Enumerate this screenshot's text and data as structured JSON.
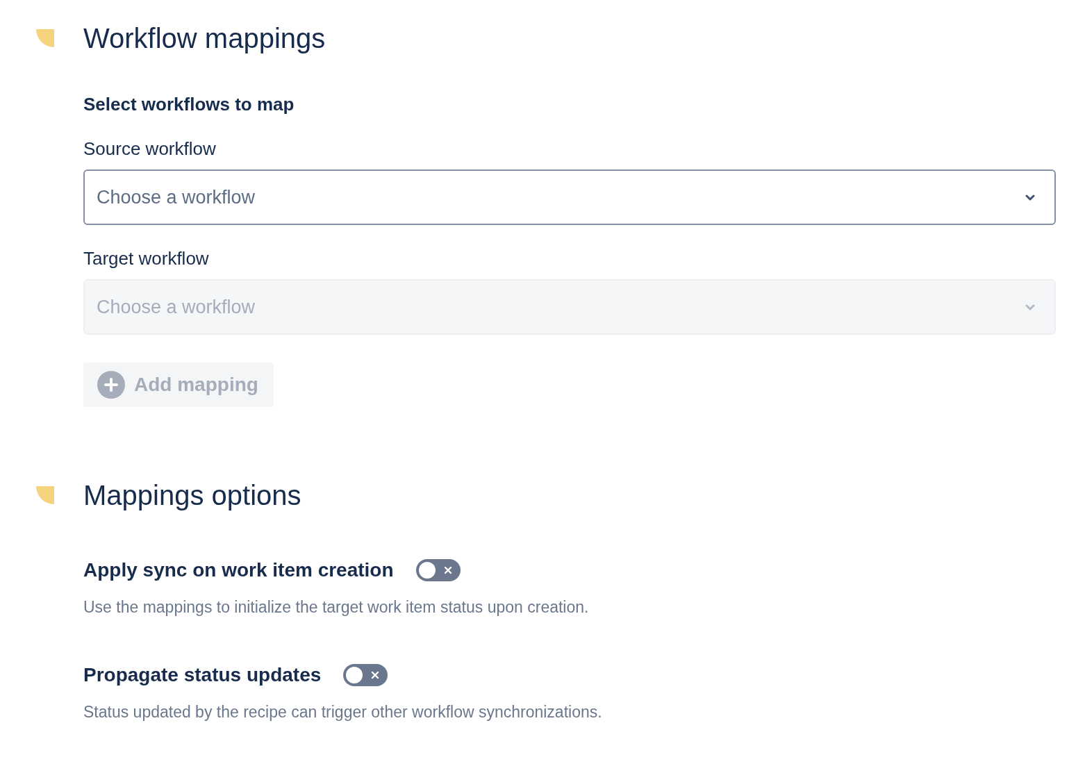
{
  "sections": [
    {
      "kind": "workflows",
      "title": "Workflow mappings",
      "subtitle": "Select workflows to map",
      "fields": [
        {
          "label": "Source workflow",
          "placeholder": "Choose a workflow",
          "disabled": false
        },
        {
          "label": "Target workflow",
          "placeholder": "Choose a workflow",
          "disabled": true
        }
      ],
      "add_button": {
        "label": "Add mapping",
        "disabled": true
      }
    },
    {
      "kind": "options",
      "title": "Mappings options",
      "options": [
        {
          "label": "Apply sync on work item creation",
          "on": false,
          "description": "Use the mappings to initialize the target work item status upon creation."
        },
        {
          "label": "Propagate status updates",
          "on": false,
          "description": "Status updated by the recipe can trigger other workflow synchronizations."
        }
      ]
    }
  ]
}
